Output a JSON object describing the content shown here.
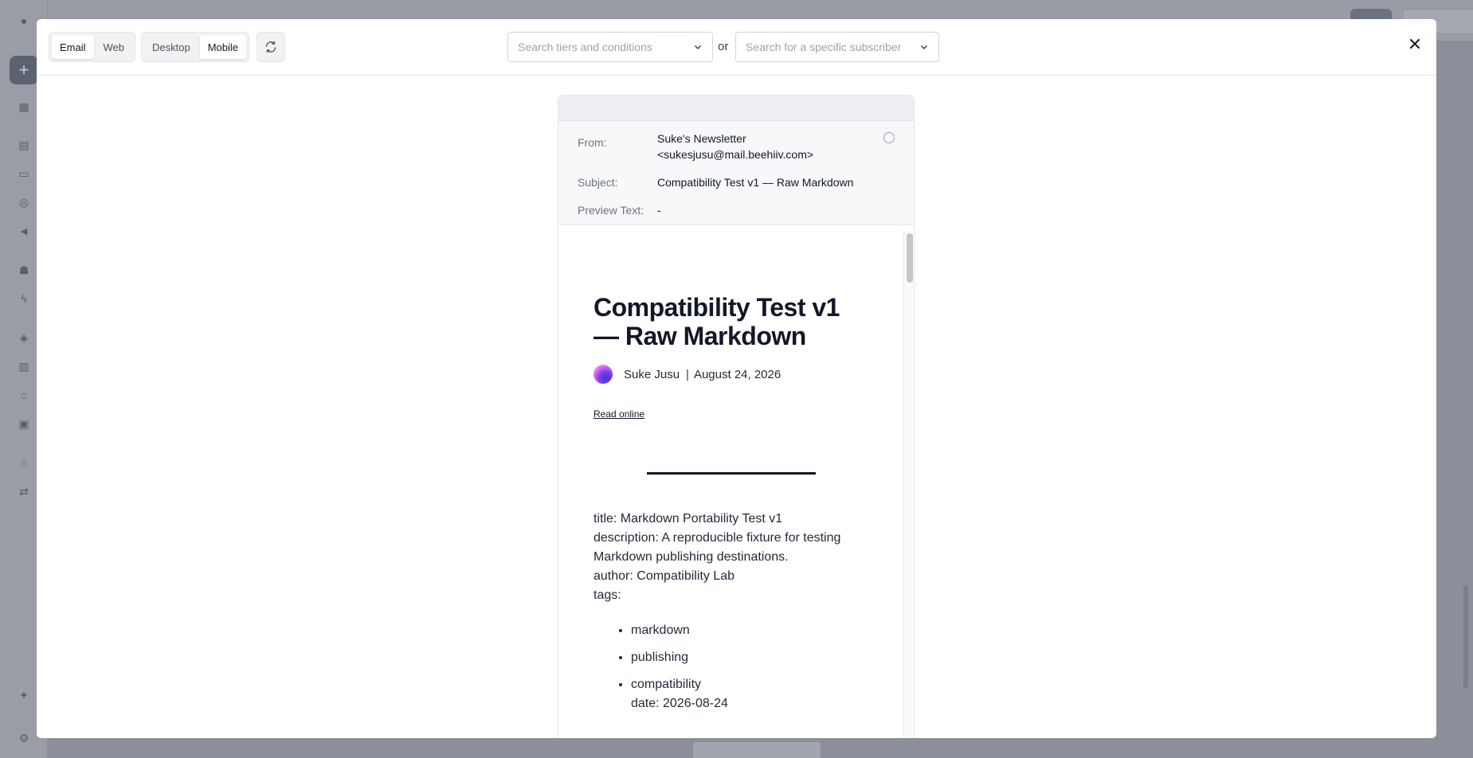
{
  "modal": {
    "channel_tabs": [
      {
        "label": "Email",
        "active": true
      },
      {
        "label": "Web",
        "active": false
      }
    ],
    "device_tabs": [
      {
        "label": "Desktop",
        "active": false
      },
      {
        "label": "Mobile",
        "active": true
      }
    ],
    "tier_select_placeholder": "Search tiers and conditions",
    "or_label": "or",
    "subscriber_select_placeholder": "Search for a specific subscriber"
  },
  "email": {
    "from_label": "From:",
    "from_name": "Suke's Newsletter",
    "from_address": "<sukesjusu@mail.beehiiv.com>",
    "subject_label": "Subject:",
    "subject_value": "Compatibility Test v1 — Raw Markdown",
    "preview_label": "Preview Text:",
    "preview_value": "-"
  },
  "post": {
    "title": "Compatibility Test v1 — Raw Markdown",
    "author": "Suke Jusu",
    "separator": "|",
    "date": "August 24, 2026",
    "read_online": "Read online",
    "body_lines": [
      "title: Markdown Portability Test v1",
      "description: A reproducible fixture for testing Markdown publishing destinations.",
      "author: Compatibility Lab",
      "tags:"
    ],
    "tags": [
      "markdown",
      "publishing",
      "compatibility"
    ],
    "date_line": "date: 2026-08-24"
  },
  "colors": {
    "overlay": "#8b8f99",
    "modal_bg": "#ffffff",
    "text_primary": "#111827",
    "text_muted": "#6b7280"
  }
}
